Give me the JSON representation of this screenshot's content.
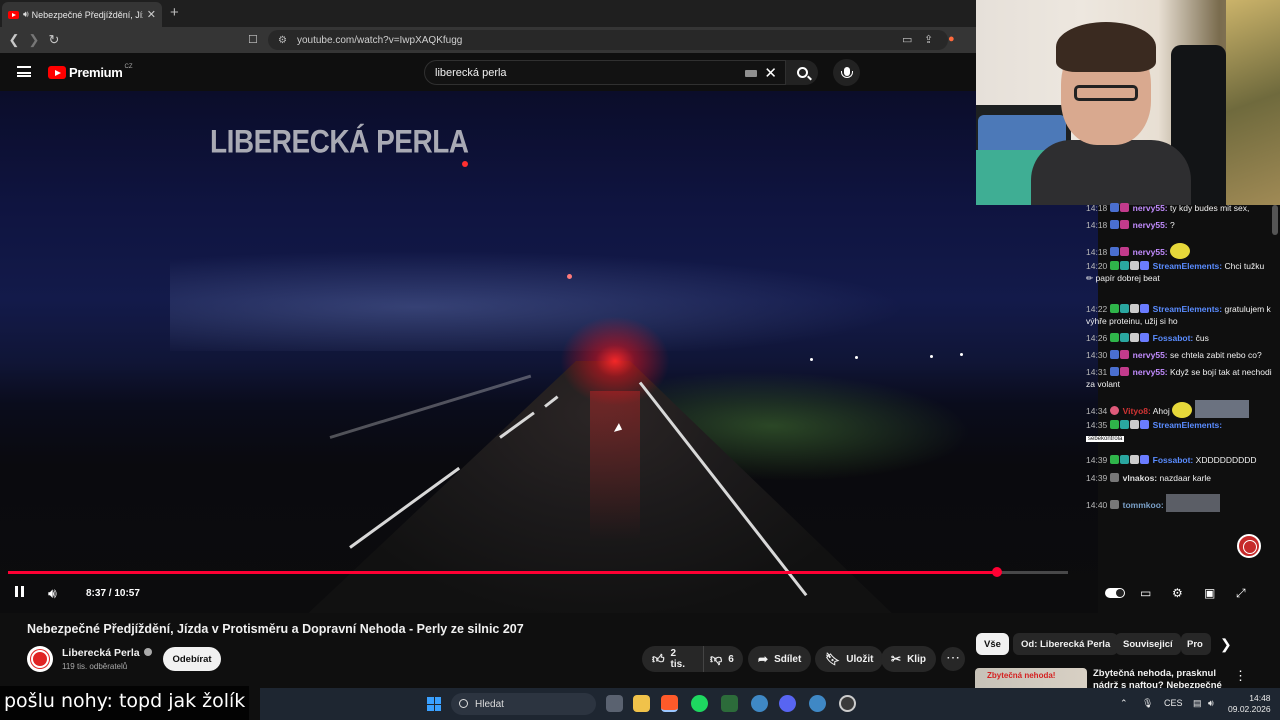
{
  "browser": {
    "tab_title": "Nebezpečné Předjíždění, Jízda",
    "url": "youtube.com/watch?v=IwpXAQKfugg"
  },
  "youtube": {
    "logo_text": "Premium",
    "logo_country": "CZ",
    "search_value": "liberecká perla"
  },
  "player": {
    "overlay_title": "LIBERECKÁ PERLA",
    "time": "8:37 / 10:57",
    "progress": 0.933,
    "buffered": 0.995
  },
  "video": {
    "title": "Nebezpečné Předjíždění, Jízda v Protisměru a Dopravní Nehoda - Perly ze silnic 207",
    "channel": "Liberecká Perla",
    "subscribers": "119 tis. odběratelů",
    "unsubscribe_label": "Odebírat",
    "likes": "2 tis.",
    "dislikes": "6",
    "share_label": "Sdílet",
    "save_label": "Uložit",
    "clip_label": "Klip"
  },
  "chips": [
    "Vše",
    "Od: Liberecká Perla",
    "Souvisejicí",
    "Pro"
  ],
  "recommendation": {
    "thumb_text": "Zbytečná nehoda!",
    "title": "Zbytečná nehoda, prasknul nádrž s naftou? Nebezpečné"
  },
  "chat": [
    {
      "time": "14:18",
      "user": "nervy55:",
      "user_color": "#c28cff",
      "text": "ty kdy budes mit sex,"
    },
    {
      "time": "14:18",
      "user": "nervy55:",
      "user_color": "#c28cff",
      "text": "?"
    },
    {
      "time": "14:18",
      "user": "nervy55:",
      "user_color": "#c28cff",
      "text": ""
    },
    {
      "time": "14:20",
      "user": "StreamElements:",
      "user_color": "#5a8cff",
      "text": "Chci tužku ✏ papír dobrej beat"
    },
    {
      "time": "14:22",
      "user": "StreamElements:",
      "user_color": "#5a8cff",
      "text": "gratulujem k výhře proteinu, užij si ho"
    },
    {
      "time": "14:26",
      "user": "Fossabot:",
      "user_color": "#5a8cff",
      "text": "čus"
    },
    {
      "time": "14:30",
      "user": "nervy55:",
      "user_color": "#c28cff",
      "text": "se chtela zabit nebo co?"
    },
    {
      "time": "14:31",
      "user": "nervy55:",
      "user_color": "#c28cff",
      "text": "Když se bojí tak at nechodi za volant"
    },
    {
      "time": "14:34",
      "user": "Vityo8:",
      "user_color": "#d23434",
      "text": "Ahoj"
    },
    {
      "time": "14:35",
      "user": "StreamElements:",
      "user_color": "#5a8cff",
      "text": "sebekontrola"
    },
    {
      "time": "14:39",
      "user": "Fossabot:",
      "user_color": "#5a8cff",
      "text": "XDDDDDDDDD"
    },
    {
      "time": "14:39",
      "user": "vlnakos:",
      "user_color": "#dddddd",
      "text": "nazdaar karle"
    },
    {
      "time": "14:40",
      "user": "tommkoo:",
      "user_color": "#7aa0c8",
      "text": ""
    }
  ],
  "caption": "pošlu nohy: topd jak žolík",
  "taskbar": {
    "search_placeholder": "Hledat",
    "language": "CES",
    "time": "14:48",
    "date": "09.02.2026"
  },
  "colors": {
    "youtube_red": "#ff0000",
    "progress_red": "#ff0033",
    "taskbar": "#1e2631"
  },
  "icons": [
    "back-icon",
    "forward-icon",
    "reload-icon",
    "bookmark-icon",
    "menu-icon",
    "search-icon",
    "mic-icon",
    "pause-icon",
    "volume-icon",
    "settings-icon",
    "subtitles-icon",
    "fullscreen-icon",
    "like-icon",
    "dislike-icon",
    "share-icon",
    "save-icon",
    "scissors-icon",
    "more-icon"
  ]
}
